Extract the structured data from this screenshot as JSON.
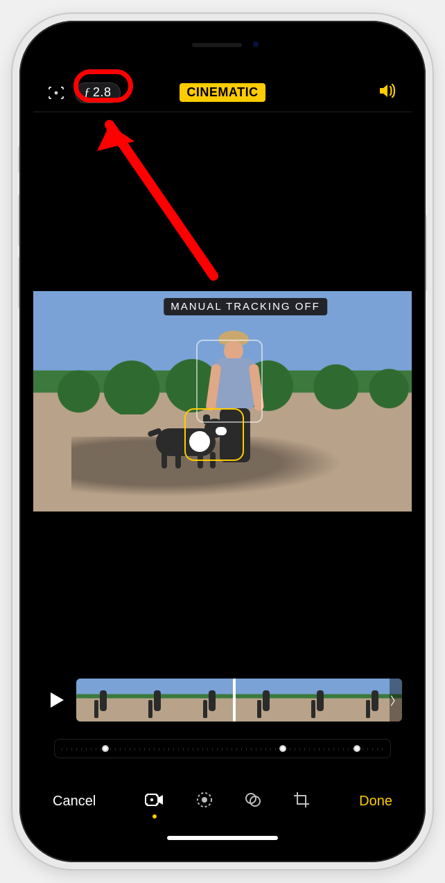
{
  "topbar": {
    "aperture": {
      "prefix": "ƒ",
      "value": "2.8"
    },
    "mode_label": "CINEMATIC"
  },
  "preview": {
    "tracking_status": "MANUAL TRACKING OFF"
  },
  "timeline": {
    "handle_left_glyph": "〈",
    "handle_right_glyph": "〉"
  },
  "bottombar": {
    "cancel_label": "Cancel",
    "done_label": "Done"
  },
  "colors": {
    "accent": "#ffcc00",
    "annotation": "#f00"
  }
}
